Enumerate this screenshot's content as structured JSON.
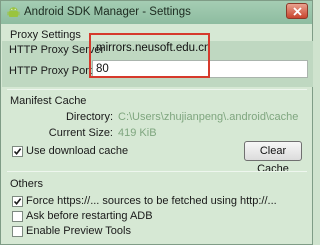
{
  "window": {
    "title": "Android SDK Manager - Settings"
  },
  "proxy": {
    "heading": "Proxy Settings",
    "server_label": "HTTP Proxy Server",
    "server_value": "mirrors.neusoft.edu.cn",
    "port_label": "HTTP Proxy Port",
    "port_value": "80"
  },
  "manifest": {
    "heading": "Manifest Cache",
    "directory_label": "Directory:",
    "directory_value": "C:\\Users\\zhujianpeng\\.android\\cache",
    "size_label": "Current Size:",
    "size_value": "419 KiB",
    "use_cache_label": "Use download cache",
    "use_cache_checked": true,
    "clear_cache_label": "Clear Cache"
  },
  "others": {
    "heading": "Others",
    "options": [
      {
        "label": "Force https://... sources to be fetched using http://...",
        "checked": true
      },
      {
        "label": "Ask before restarting ADB",
        "checked": false
      },
      {
        "label": "Enable Preview Tools",
        "checked": false
      }
    ]
  },
  "colors": {
    "highlight_box": "#d63a2c",
    "path_text": "#7fa67f",
    "background": "#d6e8d4"
  },
  "icons": {
    "app": "android-icon",
    "close": "close-icon",
    "check": "check-icon"
  }
}
